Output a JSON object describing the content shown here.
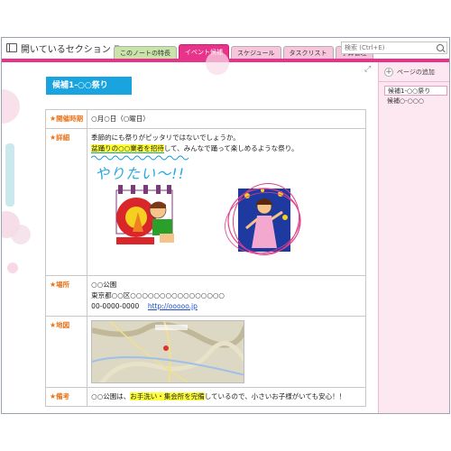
{
  "header": {
    "section_title": "開いているセクション",
    "search_placeholder": "検索 (Ctrl+E)"
  },
  "tabs": [
    {
      "label": "このノートの特長",
      "color": "#c9e4a8"
    },
    {
      "label": "イベント候補",
      "color": "#e7348a"
    },
    {
      "label": "スケジュール",
      "color": "#f7c6dc"
    },
    {
      "label": "タスクリスト",
      "color": "#f7c6dc"
    },
    {
      "label": "予算管理",
      "color": "#f7c6dc"
    }
  ],
  "page": {
    "title": "候補1-○○祭り",
    "title_color": "#19a4e0",
    "rows": {
      "date": {
        "label": "開催時期",
        "value": "○月○日（○曜日）"
      },
      "detail": {
        "label": "詳細",
        "line1": "季節的にも祭りがピッタリではないでしょうか。",
        "line2_highlight": "盆踊りの○○業者を招待",
        "line2_rest": "して、みんなで踊って楽しめるような祭り。",
        "handwriting": "やりたい〜!!"
      },
      "place": {
        "label": "場所",
        "name": "○○公園",
        "address": "東京都○○区○○○○○○○○○○○○○○○○",
        "phone": "00-0000-0000",
        "url": "http://ooooo.jp"
      },
      "map": {
        "label": "地図"
      },
      "note": {
        "label": "備考",
        "pre": "○○公園は、",
        "highlight": "お手洗い・集会所を完備",
        "post": "しているので、小さいお子様がいても安心！！"
      }
    }
  },
  "sidebar": {
    "add_page": "ページの追加",
    "pages": [
      "候補1-○○祭り",
      "候補○-○○○"
    ]
  },
  "colors": {
    "accent_pink": "#e7348a",
    "label_orange": "#e8741a",
    "sidebar_bg": "#fde8f2"
  }
}
